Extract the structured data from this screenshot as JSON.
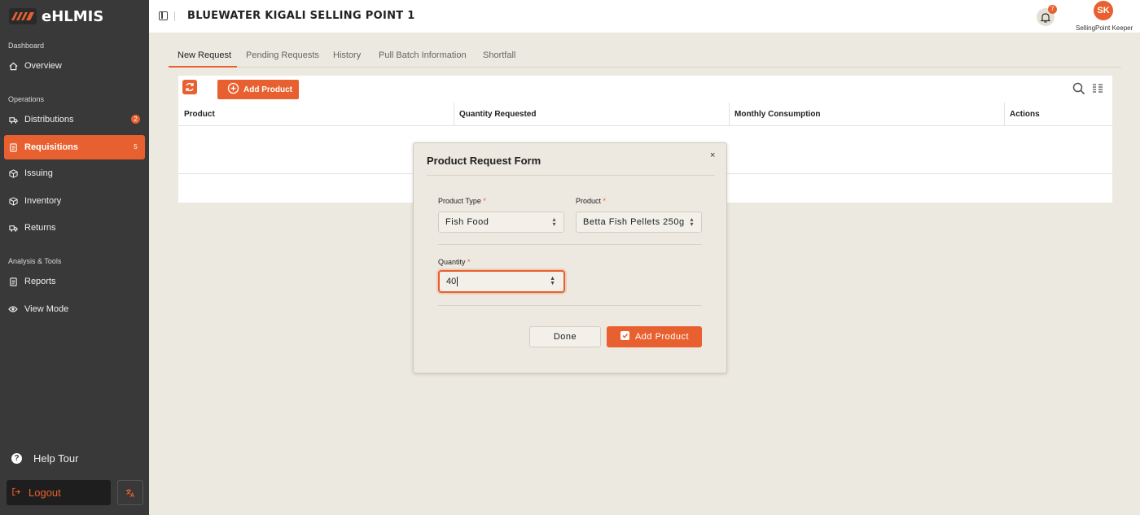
{
  "app": {
    "name": "eHLMIS",
    "accent": "#e8602f"
  },
  "sidebar": {
    "sections": [
      "Dashboard",
      "Operations",
      "Analysis & Tools"
    ],
    "items": [
      {
        "label": "Overview",
        "icon": "home-icon"
      },
      {
        "label": "Distributions",
        "icon": "truck-icon",
        "badge": "2"
      },
      {
        "label": "Requisitions",
        "icon": "document-icon",
        "badge": "5",
        "active": true
      },
      {
        "label": "Issuing",
        "icon": "package-icon"
      },
      {
        "label": "Inventory",
        "icon": "box-icon"
      },
      {
        "label": "Returns",
        "icon": "return-truck-icon"
      },
      {
        "label": "Reports",
        "icon": "report-icon"
      },
      {
        "label": "View Mode",
        "icon": "eye-icon"
      }
    ],
    "help_tour": "Help Tour",
    "logout": "Logout"
  },
  "header": {
    "title": "BLUEWATER KIGALI SELLING POINT 1",
    "notification_count": "7",
    "avatar_initials": "SK",
    "user_role": "SellingPoint Keeper"
  },
  "tabs": [
    "New Request",
    "Pending Requests",
    "History",
    "Pull Batch Information",
    "Shortfall"
  ],
  "toolbar": {
    "add_product_label": "Add Product"
  },
  "table": {
    "columns": [
      "Product",
      "Quantity Requested",
      "Monthly Consumption",
      "Actions"
    ]
  },
  "modal": {
    "title": "Product Request Form",
    "close": "×",
    "product_type_label": "Product Type",
    "product_type_value": "Fish Food",
    "product_label": "Product",
    "product_value": "Betta Fish Pellets 250g",
    "quantity_label": "Quantity",
    "quantity_value": "40",
    "required_mark": "*",
    "done_label": "Done",
    "add_label": "Add Product"
  }
}
